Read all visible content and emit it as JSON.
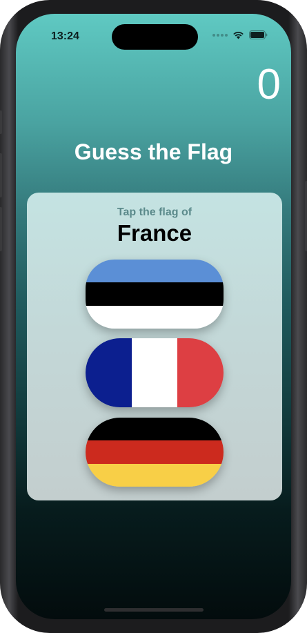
{
  "status_bar": {
    "time": "13:24"
  },
  "game": {
    "score": "0",
    "title": "Guess the Flag",
    "prompt": "Tap the flag of",
    "country": "France"
  },
  "flags": [
    {
      "icon": "estonia-flag-icon",
      "colors": [
        "#5b8fd6",
        "#000000",
        "#ffffff"
      ]
    },
    {
      "icon": "france-flag-icon",
      "colors": [
        "#0c1f8f",
        "#ffffff",
        "#dd3f43"
      ]
    },
    {
      "icon": "germany-flag-icon",
      "colors": [
        "#000000",
        "#cc2a1e",
        "#f8cf47"
      ]
    }
  ],
  "colors": {
    "background_top": "#5fc9c2",
    "background_bottom": "#030c0d",
    "prompt_text": "#5b8a8b"
  }
}
